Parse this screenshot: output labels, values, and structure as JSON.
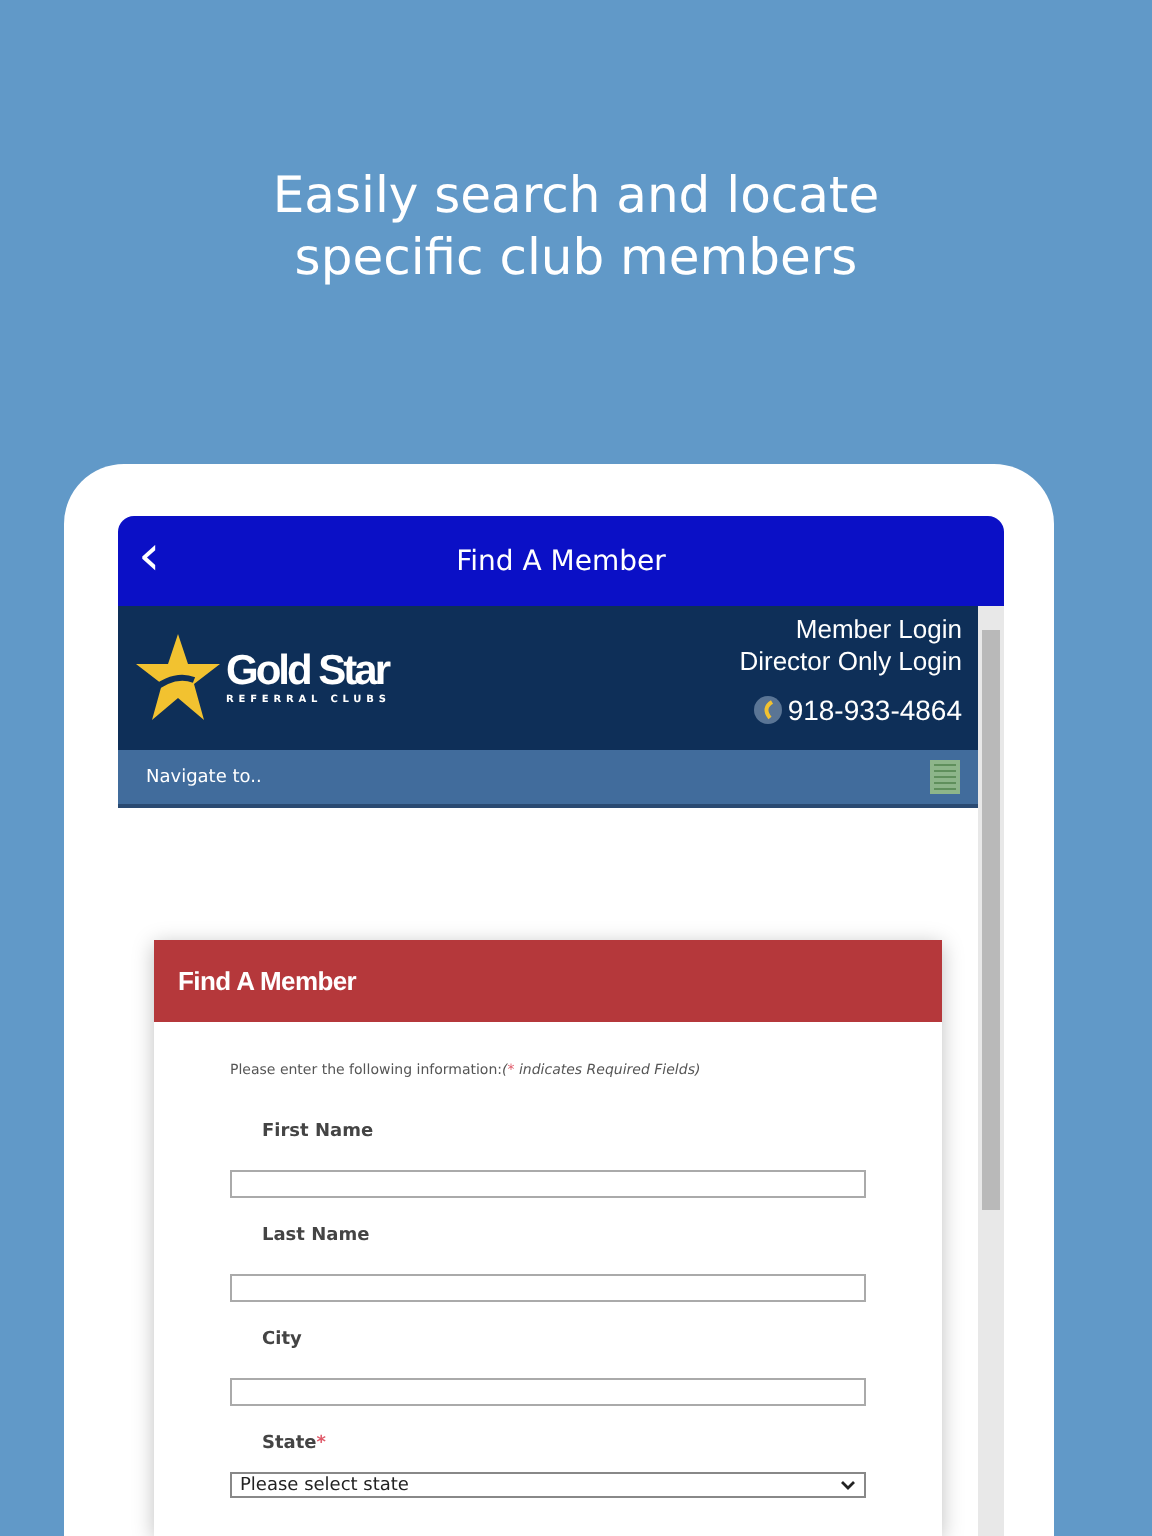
{
  "headline": [
    "Easily search and locate",
    "specific club members"
  ],
  "app_bar": {
    "back": "‹",
    "title": "Find A Member"
  },
  "site_header": {
    "logo_name": "Gold Star",
    "logo_tagline": "REFERRAL CLUBS",
    "links": [
      "Member Login",
      "Director Only Login"
    ],
    "phone": "918-933-4864"
  },
  "nav": {
    "label": "Navigate to.."
  },
  "form": {
    "title": "Find A Member",
    "instructions": "Please enter the following information:",
    "note_parts": [
      "(",
      "*",
      " indicates Required Fields)"
    ],
    "fields": [
      {
        "kind": "text",
        "label": "First Name",
        "required": false
      },
      {
        "kind": "text",
        "label": "Last Name",
        "required": false
      },
      {
        "kind": "text",
        "label": "City",
        "required": false
      },
      {
        "kind": "select",
        "label": "State",
        "required": true,
        "value": "Please select state"
      }
    ]
  }
}
